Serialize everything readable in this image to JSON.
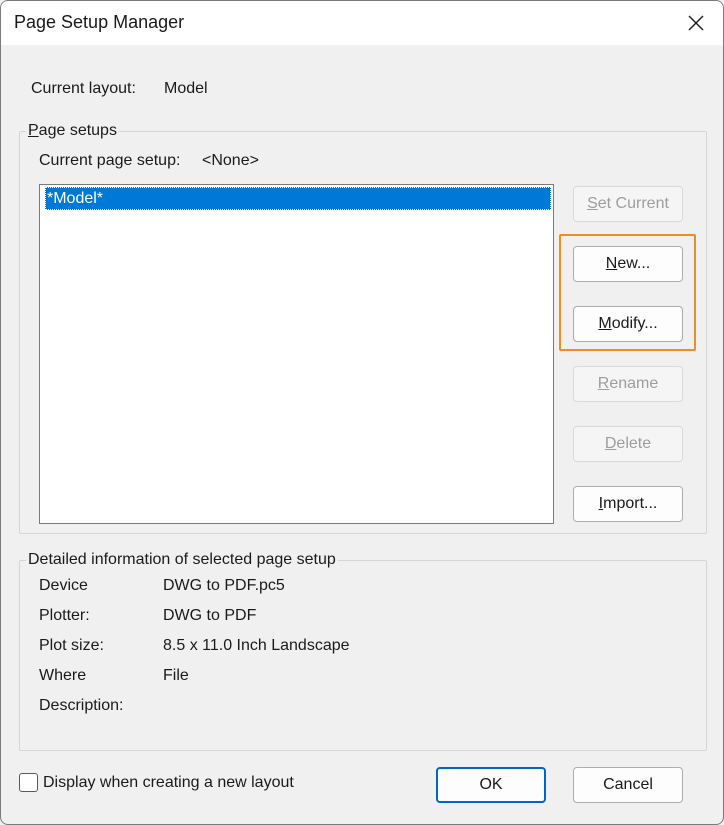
{
  "window": {
    "title": "Page Setup Manager",
    "close_icon": "close-icon"
  },
  "current_layout": {
    "label": "Current layout:",
    "value": "Model"
  },
  "page_setups": {
    "group_label_underlined": "P",
    "group_label_rest": "age setups",
    "current_label": "Current page setup:",
    "current_value": "<None>",
    "items": [
      "*Model*"
    ],
    "selected_index": 0
  },
  "buttons": {
    "set_current": {
      "ul": "S",
      "rest": "et Current"
    },
    "new": {
      "ul": "N",
      "rest": "ew..."
    },
    "modify": {
      "ul": "M",
      "rest": "odify..."
    },
    "rename": {
      "ul": "R",
      "rest": "ename"
    },
    "delete": {
      "ul": "D",
      "rest": "elete"
    },
    "import": {
      "ul": "I",
      "rest": "mport..."
    },
    "ok": "OK",
    "cancel": "Cancel"
  },
  "details": {
    "group_label": "Detailed information of selected page setup",
    "rows": [
      {
        "label": "Device",
        "value": "DWG to PDF.pc5"
      },
      {
        "label": "Plotter:",
        "value": "DWG to PDF"
      },
      {
        "label": "Plot size:",
        "value": "8.5 x 11.0 Inch Landscape"
      },
      {
        "label": "Where",
        "value": "File"
      },
      {
        "label": "Description:",
        "value": ""
      }
    ]
  },
  "checkbox": {
    "label": "Display when creating a new layout",
    "checked": false
  },
  "colors": {
    "selection": "#0078d7",
    "highlight": "#f28c1e",
    "default_border": "#0067c0"
  }
}
